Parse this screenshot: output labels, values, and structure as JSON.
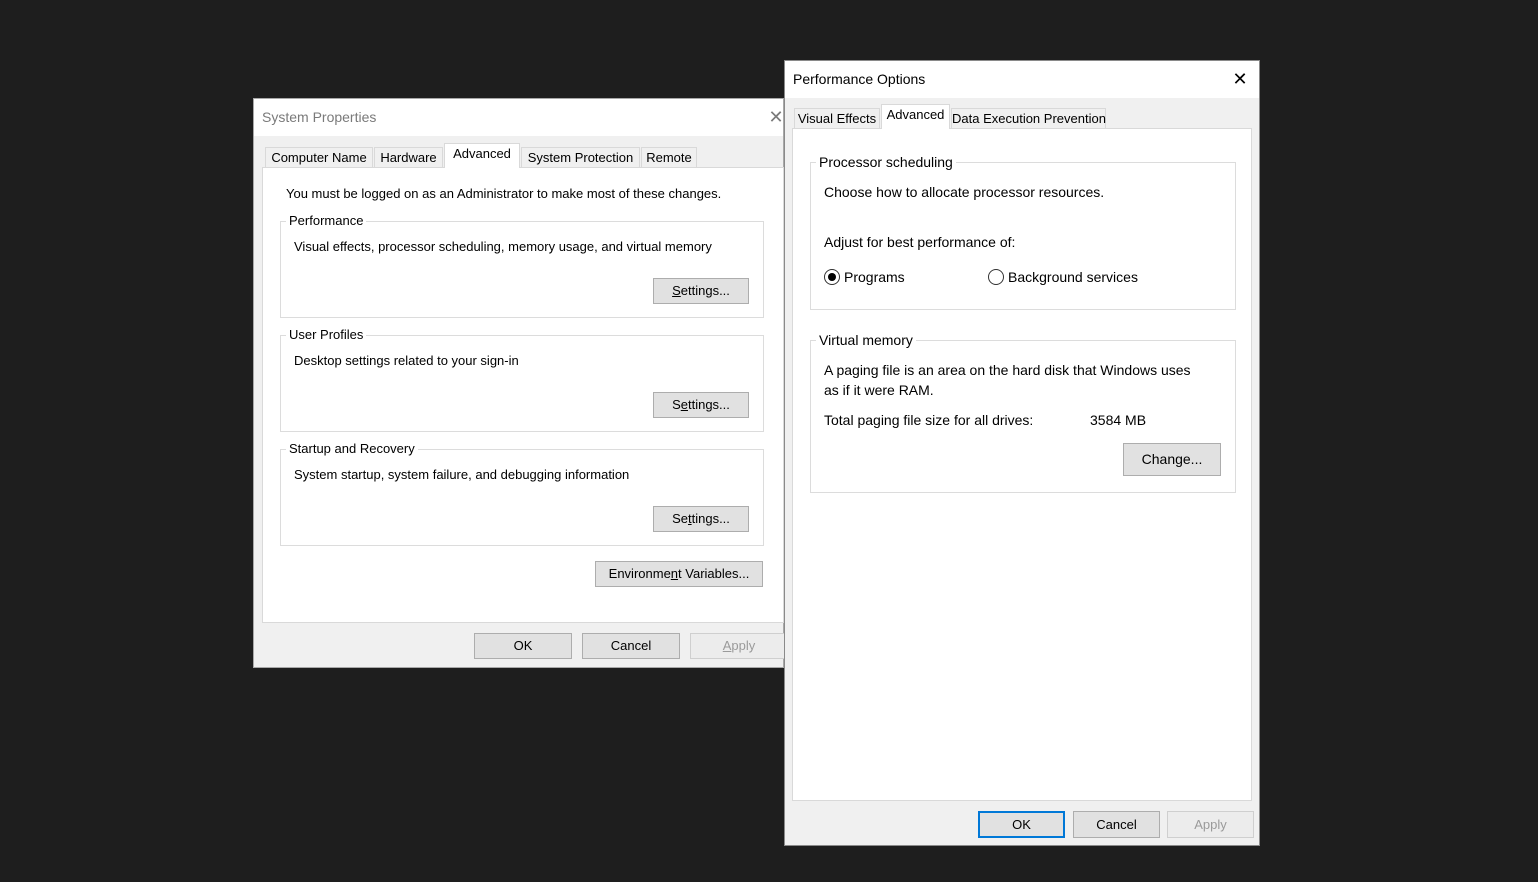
{
  "system_properties": {
    "title": "System Properties",
    "tabs": [
      "Computer Name",
      "Hardware",
      "Advanced",
      "System Protection",
      "Remote"
    ],
    "active_tab": "Advanced",
    "admin_notice": "You must be logged on as an Administrator to make most of these changes.",
    "performance": {
      "legend": "Performance",
      "description": "Visual effects, processor scheduling, memory usage, and virtual memory",
      "button": {
        "pre": "",
        "key": "S",
        "post": "ettings..."
      }
    },
    "user_profiles": {
      "legend": "User Profiles",
      "description": "Desktop settings related to your sign-in",
      "button": {
        "pre": "S",
        "key": "e",
        "post": "ttings..."
      }
    },
    "startup_recovery": {
      "legend": "Startup and Recovery",
      "description": "System startup, system failure, and debugging information",
      "button": {
        "pre": "Se",
        "key": "t",
        "post": "tings..."
      }
    },
    "env_button": {
      "pre": "Environme",
      "key": "n",
      "post": "t Variables..."
    },
    "footer": {
      "ok": "OK",
      "cancel": "Cancel",
      "apply_key": "A",
      "apply_post": "pply"
    }
  },
  "performance_options": {
    "title": "Performance Options",
    "tabs": [
      "Visual Effects",
      "Advanced",
      "Data Execution Prevention"
    ],
    "active_tab": "Advanced",
    "processor_scheduling": {
      "legend": "Processor scheduling",
      "description": "Choose how to allocate processor resources.",
      "adjust_label": "Adjust for best performance of:",
      "options": [
        {
          "label": "Programs",
          "selected": true
        },
        {
          "label": "Background services",
          "selected": false
        }
      ]
    },
    "virtual_memory": {
      "legend": "Virtual memory",
      "description_line1": "A paging file is an area on the hard disk that Windows uses",
      "description_line2": "as if it were RAM.",
      "total_label": "Total paging file size for all drives:",
      "total_value": "3584 MB",
      "change_button": "Change..."
    },
    "footer": {
      "ok": "OK",
      "cancel": "Cancel",
      "apply": "Apply"
    }
  }
}
